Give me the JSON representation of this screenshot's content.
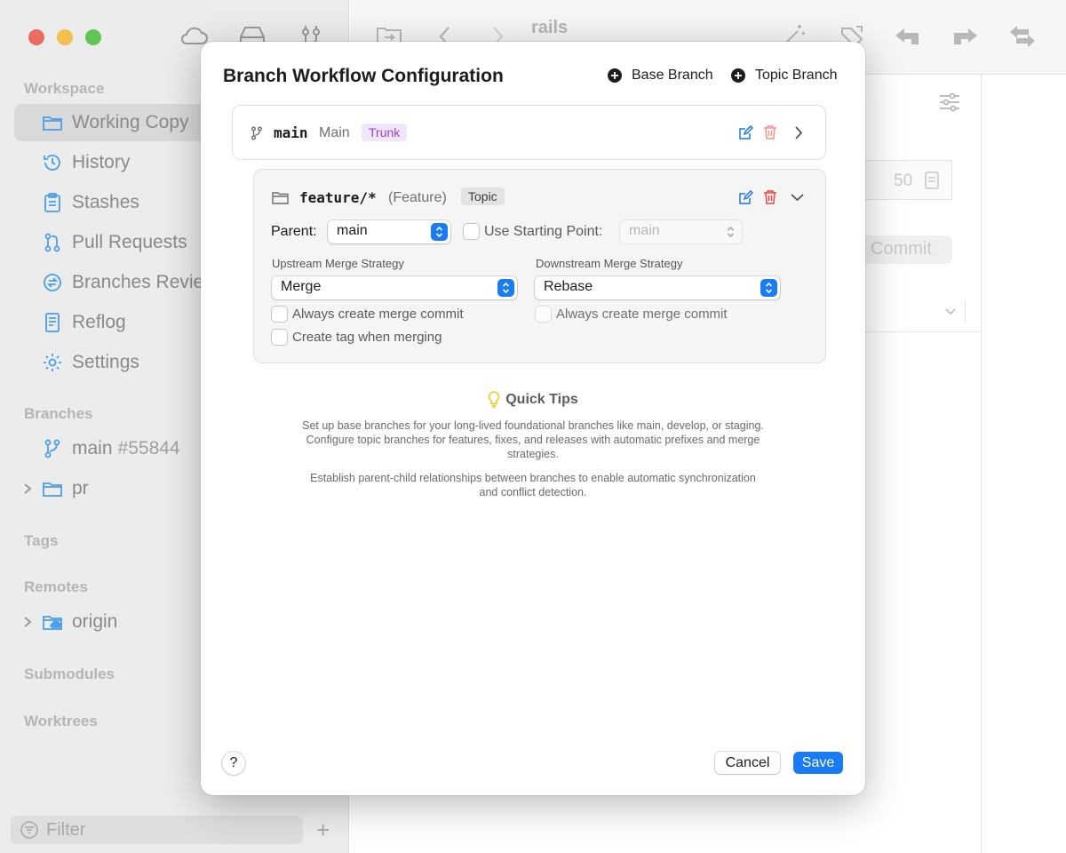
{
  "window": {
    "repo_title": "rails"
  },
  "sidebar": {
    "sections": {
      "workspace": "Workspace",
      "branches": "Branches",
      "tags": "Tags",
      "remotes": "Remotes",
      "submodules": "Submodules",
      "worktrees": "Worktrees"
    },
    "workspace_items": [
      {
        "label": "Working Copy",
        "icon": "folder-icon"
      },
      {
        "label": "History",
        "icon": "history-icon"
      },
      {
        "label": "Stashes",
        "icon": "clipboard-icon"
      },
      {
        "label": "Pull Requests",
        "icon": "pull-request-icon"
      },
      {
        "label": "Branches Revie",
        "icon": "branch-review-icon"
      },
      {
        "label": "Reflog",
        "icon": "book-icon"
      },
      {
        "label": "Settings",
        "icon": "gear-icon"
      }
    ],
    "branch_items": [
      {
        "label": "main",
        "suffix": "#55844"
      },
      {
        "label": "pr"
      }
    ],
    "remote_items": [
      {
        "label": "origin"
      }
    ],
    "filter_placeholder": "Filter",
    "add_label": "+"
  },
  "background": {
    "field_value": "50",
    "commit_label": "Commit"
  },
  "modal": {
    "title": "Branch Workflow Configuration",
    "add_base_label": "Base Branch",
    "add_topic_label": "Topic Branch",
    "main_branch": {
      "name": "main",
      "label": "Main",
      "badge": "Trunk"
    },
    "topic_branch": {
      "name": "feature/*",
      "label": "(Feature)",
      "badge": "Topic",
      "parent_label": "Parent:",
      "parent_value": "main",
      "starting_point_label": "Use Starting Point:",
      "starting_point_value": "main",
      "upstream_header": "Upstream Merge Strategy",
      "upstream_value": "Merge",
      "downstream_header": "Downstream Merge Strategy",
      "downstream_value": "Rebase",
      "upstream_merge_commit": "Always create merge commit",
      "create_tag": "Create tag when merging",
      "downstream_merge_commit": "Always create merge commit"
    },
    "tips": {
      "title": "Quick Tips",
      "paragraph1": "Set up base branches for your long-lived foundational branches like main, develop, or staging. Configure topic branches for features, fixes, and releases with automatic prefixes and merge strategies.",
      "paragraph2": "Establish parent-child relationships between branches to enable automatic synchronization and conflict detection."
    },
    "help_label": "?",
    "cancel_label": "Cancel",
    "save_label": "Save"
  },
  "colors": {
    "accent": "#1a7cf5",
    "delete": "#e8453c",
    "trunk_badge": "#9a3fd0"
  }
}
